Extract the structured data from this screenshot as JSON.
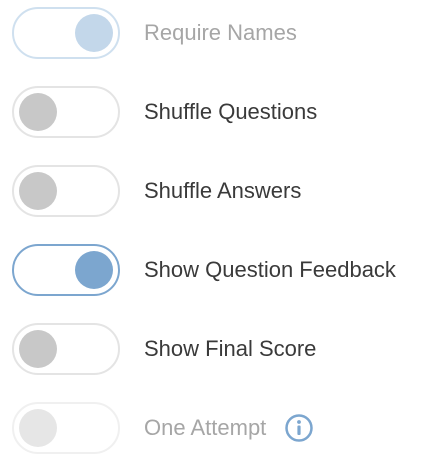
{
  "settings": [
    {
      "label": "Require Names",
      "state": "on",
      "disabled": true
    },
    {
      "label": "Shuffle Questions",
      "state": "off",
      "disabled": false
    },
    {
      "label": "Shuffle Answers",
      "state": "off",
      "disabled": false
    },
    {
      "label": "Show Question Feedback",
      "state": "on",
      "disabled": false
    },
    {
      "label": "Show Final Score",
      "state": "off",
      "disabled": false
    },
    {
      "label": "One Attempt",
      "state": "off",
      "disabled": true,
      "info_icon": "info-icon"
    }
  ],
  "colors": {
    "accent": "#7ca6cf",
    "accent_disabled": "#c3d7ea",
    "knob_off": "#c8c8c8",
    "text": "#3a3a3a",
    "text_disabled": "#a6a6a6"
  }
}
